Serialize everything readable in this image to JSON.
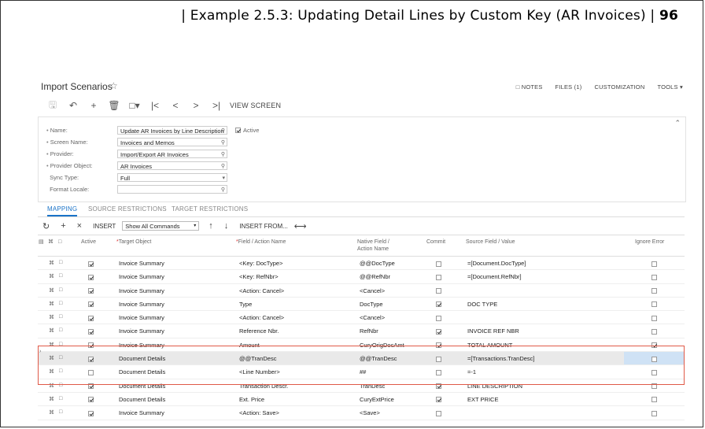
{
  "doc_header": {
    "prefix": "| Example 2.5.3: Updating Detail Lines by Custom Key (AR Invoices) | ",
    "page": "96"
  },
  "screen": {
    "title": "Import Scenarios",
    "star": "☆"
  },
  "top_links": [
    "NOTES",
    "FILES (1)",
    "CUSTOMIZATION",
    "TOOLS ▾"
  ],
  "toolbar": {
    "view_screen": "VIEW SCREEN"
  },
  "form": {
    "name_label": "Name:",
    "name_value": "Update AR Invoices by Line Description",
    "screen_label": "Screen Name:",
    "screen_value": "Invoices and Memos",
    "provider_label": "Provider:",
    "provider_value": "Import/Export AR Invoices",
    "provobj_label": "Provider Object:",
    "provobj_value": "AR Invoices",
    "sync_label": "Sync Type:",
    "sync_value": "Full",
    "locale_label": "Format Locale:",
    "locale_value": "",
    "active_label": "Active"
  },
  "tabs": [
    "MAPPING",
    "SOURCE RESTRICTIONS",
    "TARGET RESTRICTIONS"
  ],
  "grid_toolbar": {
    "insert": "INSERT",
    "command_filter": "Show All Commands",
    "insert_from": "INSERT FROM..."
  },
  "columns": {
    "active": "Active",
    "target_object": "Target Object",
    "field_action": "Field / Action Name",
    "native_field": "Native Field /",
    "native_field2": "Action Name",
    "commit": "Commit",
    "source_field": "Source Field / Value",
    "ignore_error": "Ignore Error"
  },
  "rows": [
    {
      "active": true,
      "target": "Invoice Summary",
      "field": "<Key: DocType>",
      "native": "@@DocType",
      "commit": false,
      "source": "=[Document.DocType]",
      "ignore": false
    },
    {
      "active": true,
      "target": "Invoice Summary",
      "field": "<Key: RefNbr>",
      "native": "@@RefNbr",
      "commit": false,
      "source": "=[Document.RefNbr]",
      "ignore": false
    },
    {
      "active": true,
      "target": "Invoice Summary",
      "field": "<Action: Cancel>",
      "native": "<Cancel>",
      "commit": false,
      "source": "",
      "ignore": false
    },
    {
      "active": true,
      "target": "Invoice Summary",
      "field": "Type",
      "native": "DocType",
      "commit": true,
      "source": "DOC TYPE",
      "ignore": false
    },
    {
      "active": true,
      "target": "Invoice Summary",
      "field": "<Action: Cancel>",
      "native": "<Cancel>",
      "commit": false,
      "source": "",
      "ignore": false
    },
    {
      "active": true,
      "target": "Invoice Summary",
      "field": "Reference Nbr.",
      "native": "RefNbr",
      "commit": true,
      "source": "INVOICE REF NBR",
      "ignore": false
    },
    {
      "active": true,
      "target": "Invoice Summary",
      "field": "Amount",
      "native": "CuryOrigDocAmt",
      "commit": true,
      "source": "TOTAL AMOUNT",
      "ignore": true
    },
    {
      "active": true,
      "target": "Document Details",
      "field": "@@TranDesc",
      "native": "@@TranDesc",
      "commit": false,
      "source": "=[Transactions.TranDesc]",
      "ignore": false
    },
    {
      "active": false,
      "target": "Document Details",
      "field": "<Line Number>",
      "native": "##",
      "commit": false,
      "source": "=-1",
      "ignore": false
    },
    {
      "active": true,
      "target": "Document Details",
      "field": "Transaction Descr.",
      "native": "TranDesc",
      "commit": true,
      "source": "LINE DESCRIPTION",
      "ignore": false
    },
    {
      "active": true,
      "target": "Document Details",
      "field": "Ext. Price",
      "native": "CuryExtPrice",
      "commit": true,
      "source": "EXT PRICE",
      "ignore": false
    },
    {
      "active": true,
      "target": "Invoice Summary",
      "field": "<Action: Save>",
      "native": "<Save>",
      "commit": false,
      "source": "",
      "ignore": false
    }
  ],
  "selected_row": 7,
  "colors": {
    "accent": "#1a73c8",
    "highlight_border": "#e05a48",
    "selected_cell": "#cfe2f5"
  }
}
